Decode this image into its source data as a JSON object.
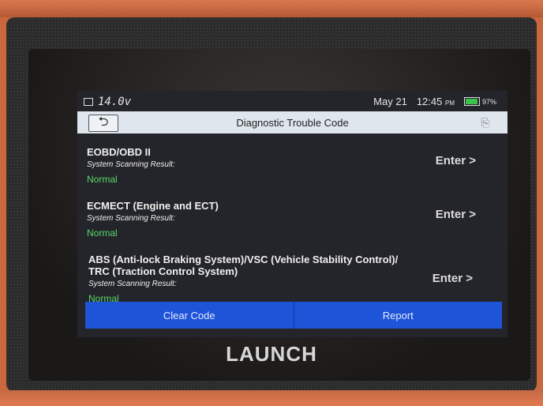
{
  "status_bar": {
    "voltage": "14.0v",
    "date": "May 21",
    "time": "12:45",
    "ampm": "PM",
    "battery_percent": "97%",
    "battery_level": 0.97
  },
  "header": {
    "title": "Diagnostic Trouble Code"
  },
  "systems": [
    {
      "name": "EOBD/OBD II",
      "line2": "",
      "result_label": "System Scanning Result:",
      "result": "Normal",
      "enter": "Enter >"
    },
    {
      "name": "ECMECT (Engine and ECT)",
      "line2": "",
      "result_label": "System Scanning Result:",
      "result": "Normal",
      "enter": "Enter >"
    },
    {
      "name": "ABS (Anti-lock Braking System)/VSC (Vehicle Stability Control)/",
      "line2": "TRC (Traction Control System)",
      "result_label": "System Scanning Result:",
      "result": "Normal",
      "enter": "Enter >"
    }
  ],
  "buttons": {
    "clear_code": "Clear Code",
    "report": "Report"
  },
  "brand": "LAUNCH",
  "colors": {
    "accent": "#1e54d8",
    "status_ok": "#58d66a",
    "case": "#c9673f"
  },
  "icons": {
    "back": "back-arrow-icon",
    "exit": "exit-icon"
  }
}
